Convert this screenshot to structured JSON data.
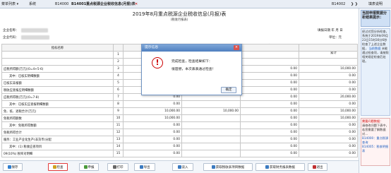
{
  "topbar": {
    "menu": "菜单列表 ▾",
    "system": "系统",
    "tab_code1": "B14000",
    "tab_code2": "B14001",
    "tab_title": "重点税源企业税收信息(月报)表",
    "close": "✕",
    "tab_code3": "B14002",
    "right_tab": "❯ ❯",
    "help": "填表说明"
  },
  "form": {
    "title": "2019年8月重点税源企业税收信息(月报)表",
    "subtitle": "(税收月报表)",
    "company_label": "企业名称：",
    "code_label": "企业代码：",
    "report_date_label": "填报日期 年 月 日",
    "unit_label": "单位：元",
    "period_label": "上年",
    "total_label": "累计"
  },
  "table": {
    "header_col": "指标名称",
    "rows": [
      {
        "name": "",
        "idx": "1",
        "v1": "",
        "v2": "",
        "v3": "",
        "v4": ""
      },
      {
        "name": "",
        "idx": "2",
        "v1": "",
        "v2": "",
        "v3": "",
        "v4": ""
      },
      {
        "name": "应税所得额(万元)(0=4+5-6)",
        "idx": "3",
        "v1": "0.00",
        "v2": "",
        "v3": "0.00",
        "v4": "10,000.00"
      },
      {
        "name": "其中：已核实明细数额",
        "idx": "4",
        "v1": "0.00",
        "v2": "",
        "v3": "0.00",
        "v4": "0.00"
      },
      {
        "name": "已核实非报额",
        "idx": "5",
        "v1": "0.00",
        "v2": "",
        "v3": "0.00",
        "v4": "0.00"
      },
      {
        "name": "税收应查报应明细数额",
        "idx": "6",
        "v1": "0.00",
        "v2": "",
        "v3": "0.00",
        "v4": "0.00"
      },
      {
        "name": "应税所得税(万元)(0=7-8)",
        "idx": "7",
        "v1": "0.00",
        "v2": "",
        "v3": "0.00",
        "v4": "20,000.00"
      },
      {
        "name": "其中：已核实应查报明细数额",
        "idx": "8",
        "v1": "0.00",
        "v2": "",
        "v3": "0.00",
        "v4": "0.00"
      },
      {
        "name": "免、抵、退税合计(万元)",
        "idx": "9",
        "v1": "10,000.00",
        "v2": "10,000.00",
        "v3": "0.00",
        "v4": "10,000.00"
      },
      {
        "name": "免税所得额数",
        "idx": "10",
        "v1": "10,000.00",
        "v2": "",
        "v3": "0.00",
        "v4": "10,000.00"
      },
      {
        "name": "其中：免税所得数额",
        "idx": "11",
        "v1": "0.00",
        "v2": "",
        "v3": "0.00",
        "v4": "0.00"
      },
      {
        "name": "免税所得合计",
        "idx": "12",
        "v1": "0.00",
        "v2": "",
        "v3": "0.00",
        "v4": "0.00"
      },
      {
        "name": "服务：工业产业化生产(非货币)分配",
        "idx": "13",
        "v1": "0.00",
        "v2": "",
        "v3": "0.00",
        "v4": "0.00"
      },
      {
        "name": "其中：(1) 税收应查项目",
        "idx": "14",
        "v1": "0.00",
        "v2": "",
        "v3": "0.00",
        "v4": "0.00"
      },
      {
        "name": "09(10%) 税率对明细",
        "idx": "15",
        "v1": "0.00",
        "v2": "",
        "v3": "0.00",
        "v4": "0.00"
      }
    ]
  },
  "buttons": [
    {
      "label": "保存",
      "icon_color": "#2f7fd0",
      "active": false
    },
    {
      "label": "检查",
      "icon_color": "#d0a020",
      "active": true
    },
    {
      "label": "申报",
      "icon_color": "#4a9a3a",
      "active": false
    },
    {
      "label": "打印",
      "icon_color": "#666666",
      "active": false
    },
    {
      "label": "导出",
      "icon_color": "#3a7ac0",
      "active": false
    },
    {
      "label": "读入",
      "icon_color": "#3a7ac0",
      "active": false
    },
    {
      "label": "获取税收表项目数据",
      "icon_color": "#3a7ac0",
      "active": false
    },
    {
      "label": "获取财务报表数据",
      "icon_color": "#3a7ac0",
      "active": false
    },
    {
      "label": "退出",
      "icon_color": "#c03030",
      "active": false
    }
  ],
  "dialog": {
    "title": "提示信息",
    "line1": "完成检查，检查结果如下：",
    "line2": "很遗憾，本次表表通过检查！",
    "ok_label": "确定"
  },
  "right_panel": {
    "heading": "当前申报数据分析结果提示：",
    "body1": "经过对您分析检查，系统于2019年09月23日15时30分6秒检查了上述企业数据，",
    "body_link": "当前数据",
    "body2": "未能通过检查项，请按照相关规定检查后处理。",
    "body3": "请修改问题下表中，若您需要了解数据对...",
    "red_title": "需要问题数据：",
    "link1": "B14000：重点税源查询",
    "link2": "B14005：税收明细表"
  },
  "colors": {
    "accent": "#4f7fbf",
    "danger": "#c00000",
    "active_outline": "#e23b3b"
  }
}
